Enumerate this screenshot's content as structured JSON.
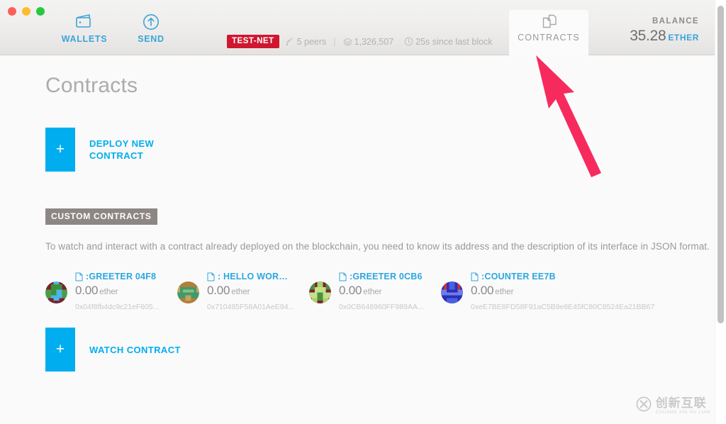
{
  "window": {
    "traffic_lights": [
      "close",
      "minimize",
      "zoom"
    ]
  },
  "header": {
    "nav": [
      {
        "id": "wallets",
        "label": "WALLETS",
        "icon": "wallet-icon",
        "active": false
      },
      {
        "id": "send",
        "label": "SEND",
        "icon": "send-up-arrow-icon",
        "active": false
      },
      {
        "id": "contracts",
        "label": "CONTRACTS",
        "icon": "documents-icon",
        "active": true
      }
    ],
    "status": {
      "network_badge": "TEST-NET",
      "peers": "5 peers",
      "separator": "|",
      "block_number": "1,326,507",
      "last_block": "25s since last block"
    },
    "balance": {
      "caption": "BALANCE",
      "amount": "35.28",
      "unit": "ETHER"
    }
  },
  "main": {
    "title": "Contracts",
    "deploy_tile": {
      "plus": "+",
      "label": "DEPLOY NEW\nCONTRACT",
      "line1": "DEPLOY NEW",
      "line2": "CONTRACT"
    },
    "section_badge": "CUSTOM CONTRACTS",
    "section_description": "To watch and interact with a contract already deployed on the blockchain, you need to know its address and the description of its interface in JSON format.",
    "contracts": [
      {
        "name": ":GREETER 04F8",
        "balance": "0.00",
        "unit": "ether",
        "address": "0x04f8fb4dc9c21eF605...",
        "icon": "document-icon",
        "avatar_colors": [
          "#3f8f3a",
          "#7c2230",
          "#49b8e8",
          "#4e9b46"
        ]
      },
      {
        "name": ": HELLO WOR…",
        "balance": "0.00",
        "unit": "ether",
        "address": "0x710485F58A01AeE94...",
        "icon": "document-icon",
        "avatar_colors": [
          "#b07f3a",
          "#3f9b6e",
          "#8fbf7a",
          "#c8a35a"
        ]
      },
      {
        "name": ":GREETER 0CB6",
        "balance": "0.00",
        "unit": "ether",
        "address": "0x0CB648960FF989AA...",
        "icon": "document-icon",
        "avatar_colors": [
          "#7c2238",
          "#c3e08a",
          "#4f8f3f",
          "#a8d46a"
        ]
      },
      {
        "name": ":COUNTER EE7B",
        "balance": "0.00",
        "unit": "ether",
        "address": "0xeE7BE8FD58F91aC5B9e8E45fC80C8524Ea21BB67",
        "icon": "document-icon",
        "avatar_colors": [
          "#2b2fb8",
          "#d0352e",
          "#4a5fe0",
          "#6f7de8"
        ]
      }
    ],
    "watch_tile": {
      "plus": "+",
      "label": "WATCH CONTRACT"
    }
  },
  "annotation": {
    "arrow": {
      "color": "#f72a5e",
      "points_to": "contracts-tab"
    }
  },
  "watermark": {
    "main": "创新互联",
    "sub": "CHUANG XIN HU LIAN",
    "logo": "circled-x-logo"
  },
  "colors": {
    "accent_blue": "#00aeef",
    "link_blue": "#2ca6e0",
    "testnet_red": "#cf1730",
    "badge_gray": "#8c8684",
    "arrow_pink": "#f72a5e",
    "body_bg": "#fafafa",
    "header_bg": "#efeeed"
  },
  "scrollbar": {
    "orientation": "vertical",
    "position": "right"
  }
}
